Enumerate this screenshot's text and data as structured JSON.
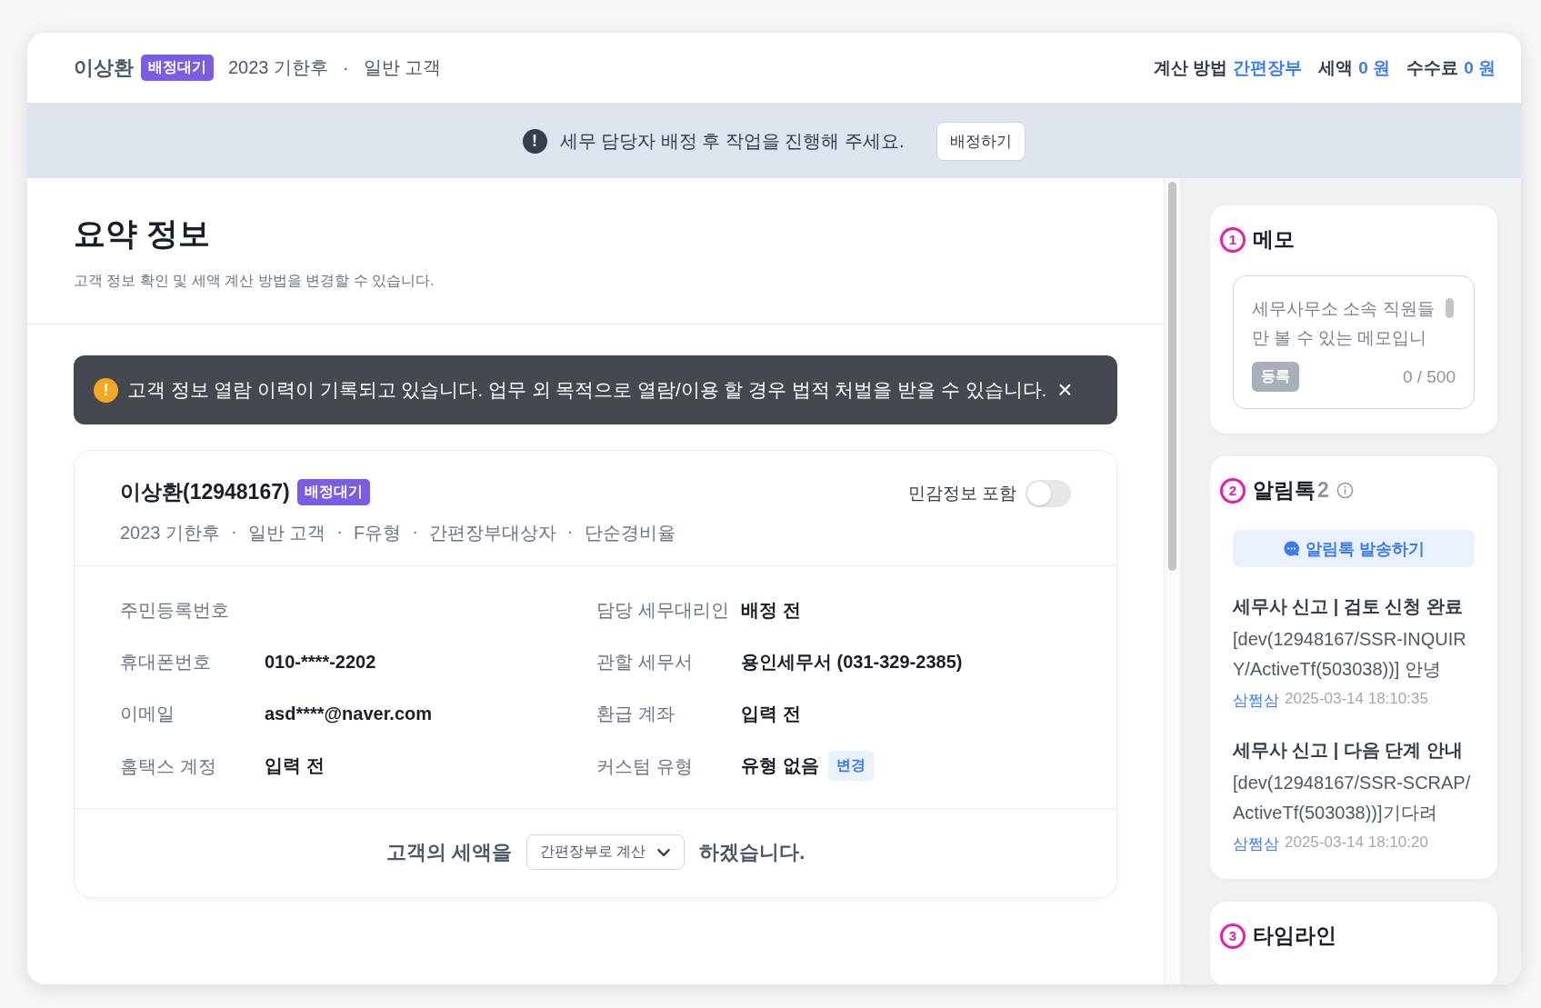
{
  "header": {
    "name": "이상환",
    "badge": "배정대기",
    "meta": [
      "2023 기한후",
      "일반 고객"
    ],
    "separator": "·",
    "summary": [
      {
        "label": "계산 방법",
        "value": "간편장부"
      },
      {
        "label": "세액",
        "value": "0 원"
      },
      {
        "label": "수수료",
        "value": "0 원"
      }
    ]
  },
  "notice": {
    "icon": "!",
    "message": "세무 담당자 배정 후 작업을 진행해 주세요.",
    "button": "배정하기"
  },
  "section": {
    "title": "요약 정보",
    "subtitle": "고객 정보 확인 및 세액 계산 방법을 변경할 수 있습니다."
  },
  "warning": {
    "icon": "!",
    "message": "고객 정보 열람 이력이 기록되고 있습니다. 업무 외 목적으로 열람/이용 할 경우 법적 처벌을 받을 수 있습니다.",
    "close": "×"
  },
  "customer": {
    "name": "이상환(12948167)",
    "badge": "배정대기",
    "sensitive": {
      "label": "민감정보 포함",
      "on": false
    },
    "tags": [
      "2023 기한후",
      "일반 고객",
      "F유형",
      "간편장부대상자",
      "단순경비율"
    ],
    "separator": "·",
    "fields": [
      {
        "label": "주민등록번호"
      },
      {
        "label": "담당 세무대리인",
        "value": "배정 전"
      },
      {
        "label": "휴대폰번호",
        "value": "010-****-2202"
      },
      {
        "label": "관할 세무서",
        "value": "용인세무서 (031-329-2385)"
      },
      {
        "label": "이메일",
        "value": "asd****@naver.com"
      },
      {
        "label": "환급 계좌",
        "value": "입력 전"
      },
      {
        "label": "홈택스 계정",
        "value": "입력 전"
      },
      {
        "label": "커스텀 유형",
        "value": "유형 없음",
        "action": "변경"
      }
    ],
    "sentence": {
      "before": "고객의 세액을",
      "select": "간편장부로 계산",
      "after": "하겠습니다."
    }
  },
  "side": {
    "memo": {
      "marker": "1",
      "title": "메모",
      "placeholder": "세무사무소 소속 직원들만 볼 수 있는 메모입니",
      "submit": "등록",
      "counter": "0 / 500"
    },
    "alimtalk": {
      "marker": "2",
      "title": "알림톡",
      "count": "2",
      "send_button": "알림톡 발송하기",
      "messages": [
        {
          "title": "세무사 신고 | 검토 신청 완료",
          "body": "[dev(12948167/SSR-INQUIRY/ActiveTf(503038))] 안녕",
          "sender": "삼쩜삼",
          "time": "2025-03-14 18:10:35"
        },
        {
          "title": "세무사 신고 | 다음 단계 안내",
          "body": "[dev(12948167/SSR-SCRAP/ActiveTf(503038))]기다려",
          "sender": "삼쩜삼",
          "time": "2025-03-14 18:10:20"
        }
      ]
    },
    "timeline": {
      "marker": "3",
      "title": "타임라인"
    }
  }
}
